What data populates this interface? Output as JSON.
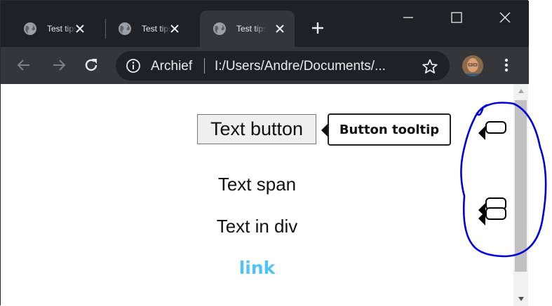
{
  "tabs": [
    {
      "title": "Test tips",
      "state": "inactive",
      "icon": "globe-icon"
    },
    {
      "title": "Test tips",
      "state": "inactive",
      "icon": "globe-icon"
    },
    {
      "title": "Test tips",
      "state": "active",
      "icon": "globe-icon"
    }
  ],
  "window_controls": [
    "minimize-icon",
    "maximize-icon",
    "close-icon"
  ],
  "toolbar": {
    "back_icon": "arrow-left-icon",
    "forward_icon": "arrow-right-icon",
    "reload_icon": "reload-icon",
    "menu_icon": "kebab-menu-icon"
  },
  "omnibox": {
    "label": "Archief",
    "url": "I:/Users/Andre/Documents/...",
    "info_icon": "info-icon",
    "star_icon": "star-icon"
  },
  "page": {
    "button_label": "Text button",
    "tooltip_text": "Button tooltip",
    "span_text": "Text span",
    "div_text": "Text in div",
    "link_text": "link"
  },
  "colors": {
    "tab_strip": "#202124",
    "toolbar": "#35363a",
    "link": "#4fc3f7",
    "annotation": "#0000dd"
  }
}
